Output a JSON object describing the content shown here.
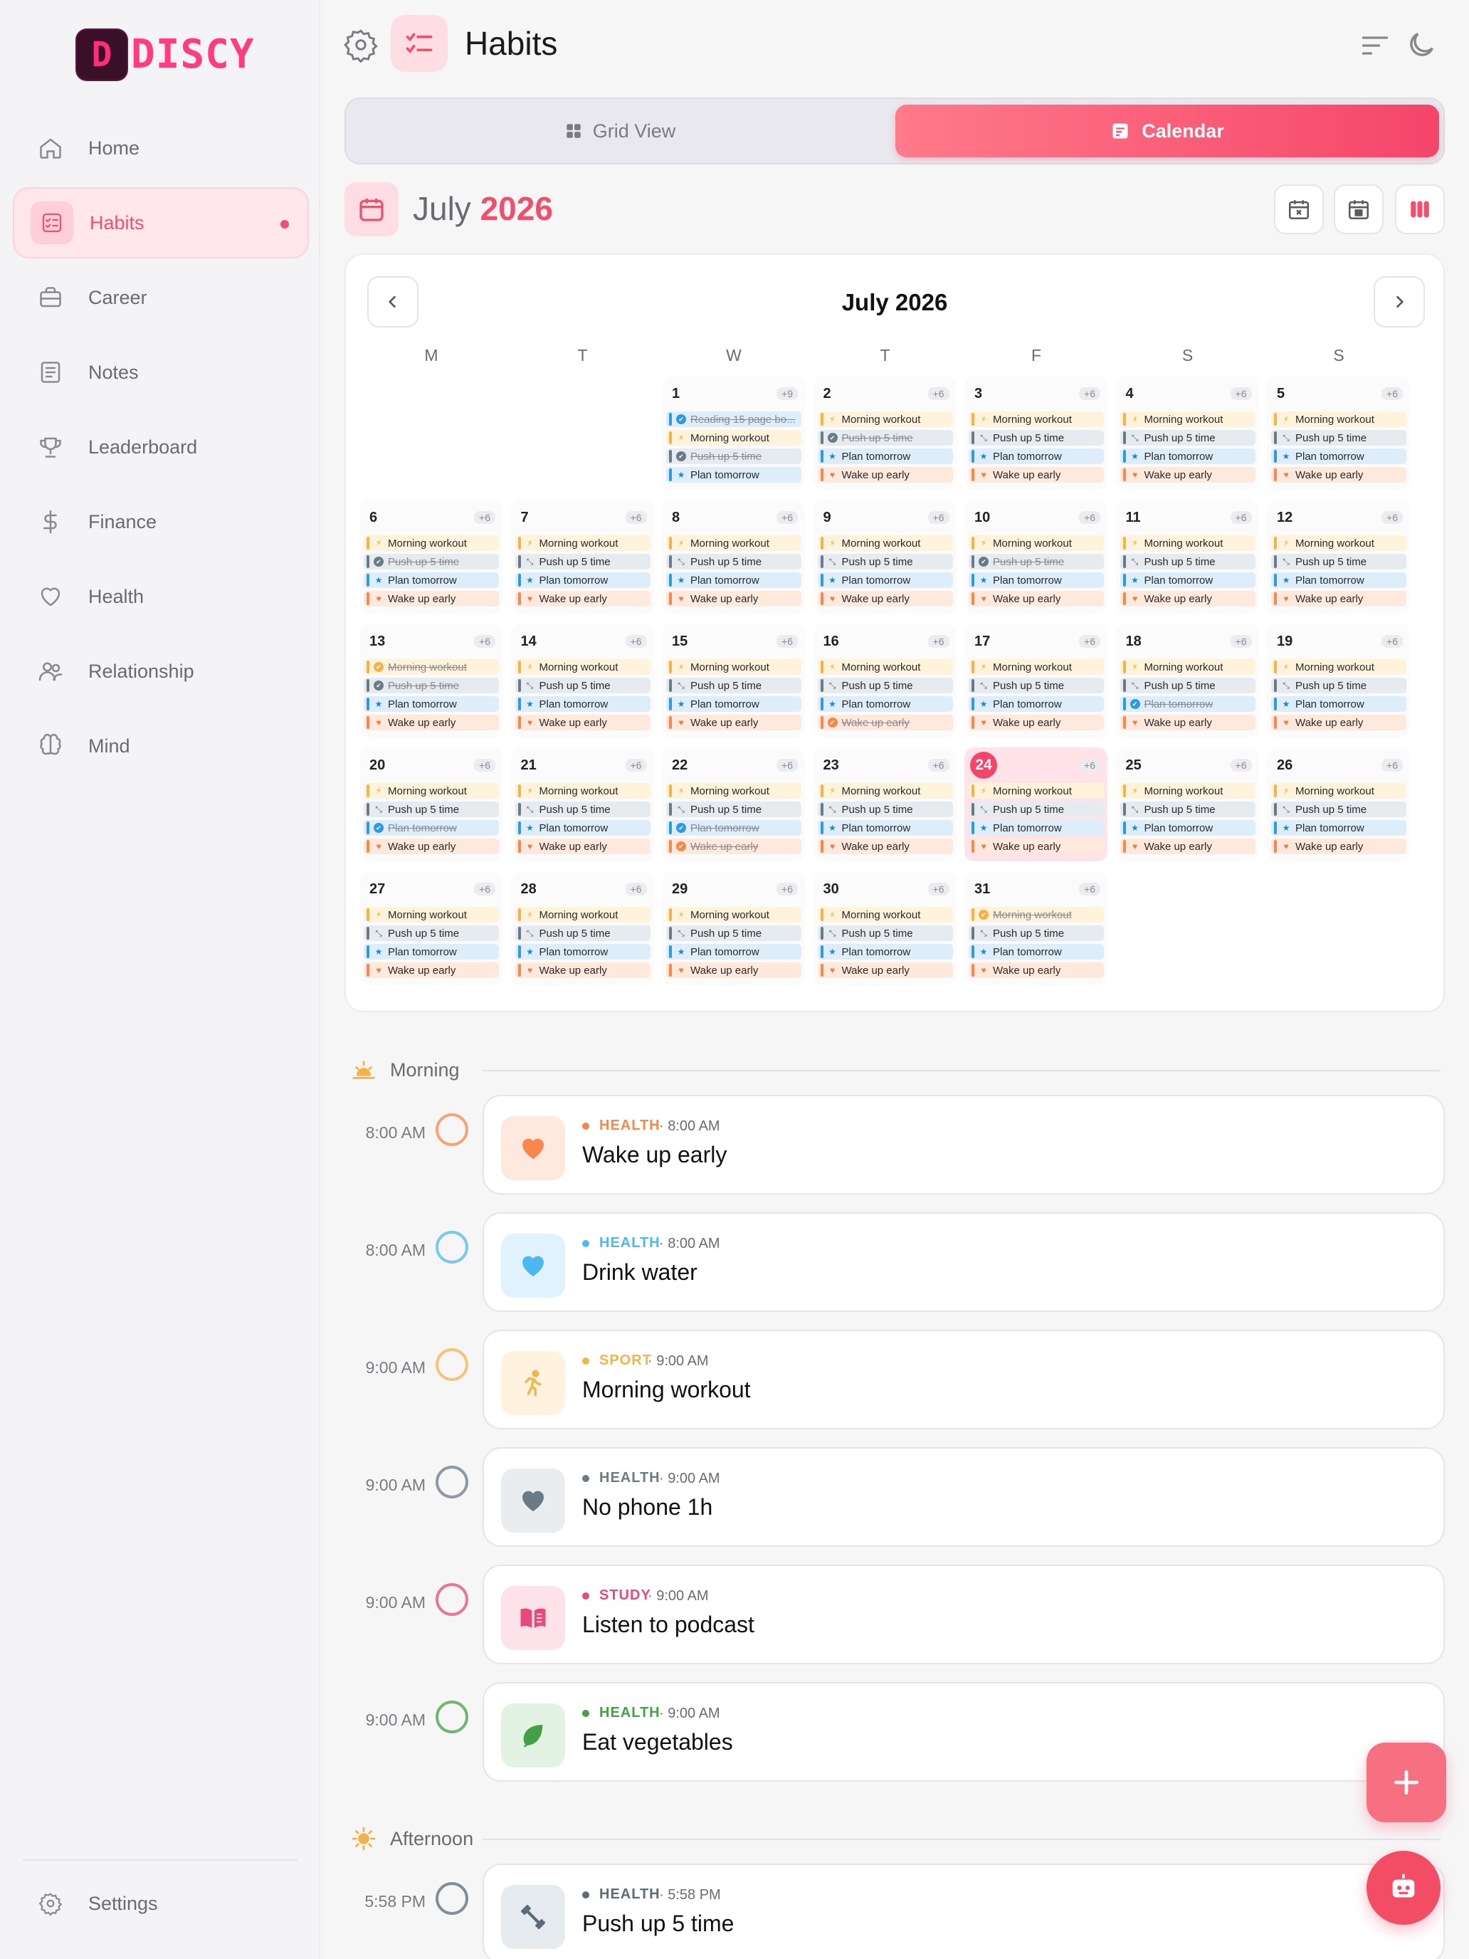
{
  "app": {
    "brand": "DISCY",
    "brand_letter": "D",
    "page_title": "Habits"
  },
  "sidebar": {
    "items": [
      {
        "label": "Home",
        "icon": "home-icon"
      },
      {
        "label": "Habits",
        "icon": "habits-icon",
        "active": true
      },
      {
        "label": "Career",
        "icon": "briefcase-icon"
      },
      {
        "label": "Notes",
        "icon": "notes-icon"
      },
      {
        "label": "Leaderboard",
        "icon": "trophy-icon"
      },
      {
        "label": "Finance",
        "icon": "dollar-icon"
      },
      {
        "label": "Health",
        "icon": "heart-icon"
      },
      {
        "label": "Relationship",
        "icon": "people-icon"
      },
      {
        "label": "Mind",
        "icon": "brain-icon"
      }
    ],
    "settings_label": "Settings"
  },
  "view_toggle": {
    "grid_label": "Grid View",
    "calendar_label": "Calendar",
    "selected": "Calendar"
  },
  "month_header": {
    "month": "July",
    "year": "2026"
  },
  "calendar": {
    "title": "July 2026",
    "weekdays": [
      "M",
      "T",
      "W",
      "T",
      "F",
      "S",
      "S"
    ],
    "first_weekday_index": 2,
    "today": 24,
    "days": [
      {
        "n": "1",
        "more": "+9",
        "events": [
          [
            "read",
            "Reading 15 page bo...",
            true
          ],
          [
            "workout",
            "Morning workout",
            false
          ],
          [
            "push",
            "Push up 5 time",
            true
          ],
          [
            "plan",
            "Plan tomorrow",
            false
          ]
        ]
      },
      {
        "n": "2",
        "more": "+6",
        "events": [
          [
            "workout",
            "Morning workout",
            false
          ],
          [
            "push",
            "Push up 5 time",
            true
          ],
          [
            "plan",
            "Plan tomorrow",
            false
          ],
          [
            "wake",
            "Wake up early",
            false
          ]
        ]
      },
      {
        "n": "3",
        "more": "+6",
        "events": [
          [
            "workout",
            "Morning workout",
            false
          ],
          [
            "push",
            "Push up 5 time",
            false
          ],
          [
            "plan",
            "Plan tomorrow",
            false
          ],
          [
            "wake",
            "Wake up early",
            false
          ]
        ]
      },
      {
        "n": "4",
        "more": "+6",
        "events": [
          [
            "workout",
            "Morning workout",
            false
          ],
          [
            "push",
            "Push up 5 time",
            false
          ],
          [
            "plan",
            "Plan tomorrow",
            false
          ],
          [
            "wake",
            "Wake up early",
            false
          ]
        ]
      },
      {
        "n": "5",
        "more": "+6",
        "events": [
          [
            "workout",
            "Morning workout",
            false
          ],
          [
            "push",
            "Push up 5 time",
            false
          ],
          [
            "plan",
            "Plan tomorrow",
            false
          ],
          [
            "wake",
            "Wake up early",
            false
          ]
        ]
      },
      {
        "n": "6",
        "more": "+6",
        "events": [
          [
            "workout",
            "Morning workout",
            false
          ],
          [
            "push",
            "Push up 5 time",
            true
          ],
          [
            "plan",
            "Plan tomorrow",
            false
          ],
          [
            "wake",
            "Wake up early",
            false
          ]
        ]
      },
      {
        "n": "7",
        "more": "+6",
        "events": [
          [
            "workout",
            "Morning workout",
            false
          ],
          [
            "push",
            "Push up 5 time",
            false
          ],
          [
            "plan",
            "Plan tomorrow",
            false
          ],
          [
            "wake",
            "Wake up early",
            false
          ]
        ]
      },
      {
        "n": "8",
        "more": "+6",
        "events": [
          [
            "workout",
            "Morning workout",
            false
          ],
          [
            "push",
            "Push up 5 time",
            false
          ],
          [
            "plan",
            "Plan tomorrow",
            false
          ],
          [
            "wake",
            "Wake up early",
            false
          ]
        ]
      },
      {
        "n": "9",
        "more": "+6",
        "events": [
          [
            "workout",
            "Morning workout",
            false
          ],
          [
            "push",
            "Push up 5 time",
            false
          ],
          [
            "plan",
            "Plan tomorrow",
            false
          ],
          [
            "wake",
            "Wake up early",
            false
          ]
        ]
      },
      {
        "n": "10",
        "more": "+6",
        "events": [
          [
            "workout",
            "Morning workout",
            false
          ],
          [
            "push",
            "Push up 5 time",
            true
          ],
          [
            "plan",
            "Plan tomorrow",
            false
          ],
          [
            "wake",
            "Wake up early",
            false
          ]
        ]
      },
      {
        "n": "11",
        "more": "+6",
        "events": [
          [
            "workout",
            "Morning workout",
            false
          ],
          [
            "push",
            "Push up 5 time",
            false
          ],
          [
            "plan",
            "Plan tomorrow",
            false
          ],
          [
            "wake",
            "Wake up early",
            false
          ]
        ]
      },
      {
        "n": "12",
        "more": "+6",
        "events": [
          [
            "workout",
            "Morning workout",
            false
          ],
          [
            "push",
            "Push up 5 time",
            false
          ],
          [
            "plan",
            "Plan tomorrow",
            false
          ],
          [
            "wake",
            "Wake up early",
            false
          ]
        ]
      },
      {
        "n": "13",
        "more": "+6",
        "events": [
          [
            "workout",
            "Morning workout",
            true
          ],
          [
            "push",
            "Push up 5 time",
            true
          ],
          [
            "plan",
            "Plan tomorrow",
            false
          ],
          [
            "wake",
            "Wake up early",
            false
          ]
        ]
      },
      {
        "n": "14",
        "more": "+6",
        "events": [
          [
            "workout",
            "Morning workout",
            false
          ],
          [
            "push",
            "Push up 5 time",
            false
          ],
          [
            "plan",
            "Plan tomorrow",
            false
          ],
          [
            "wake",
            "Wake up early",
            false
          ]
        ]
      },
      {
        "n": "15",
        "more": "+6",
        "events": [
          [
            "workout",
            "Morning workout",
            false
          ],
          [
            "push",
            "Push up 5 time",
            false
          ],
          [
            "plan",
            "Plan tomorrow",
            false
          ],
          [
            "wake",
            "Wake up early",
            false
          ]
        ]
      },
      {
        "n": "16",
        "more": "+6",
        "events": [
          [
            "workout",
            "Morning workout",
            false
          ],
          [
            "push",
            "Push up 5 time",
            false
          ],
          [
            "plan",
            "Plan tomorrow",
            false
          ],
          [
            "wake",
            "Wake up early",
            true
          ]
        ]
      },
      {
        "n": "17",
        "more": "+6",
        "events": [
          [
            "workout",
            "Morning workout",
            false
          ],
          [
            "push",
            "Push up 5 time",
            false
          ],
          [
            "plan",
            "Plan tomorrow",
            false
          ],
          [
            "wake",
            "Wake up early",
            false
          ]
        ]
      },
      {
        "n": "18",
        "more": "+6",
        "events": [
          [
            "workout",
            "Morning workout",
            false
          ],
          [
            "push",
            "Push up 5 time",
            false
          ],
          [
            "plan",
            "Plan tomorrow",
            true
          ],
          [
            "wake",
            "Wake up early",
            false
          ]
        ]
      },
      {
        "n": "19",
        "more": "+6",
        "events": [
          [
            "workout",
            "Morning workout",
            false
          ],
          [
            "push",
            "Push up 5 time",
            false
          ],
          [
            "plan",
            "Plan tomorrow",
            false
          ],
          [
            "wake",
            "Wake up early",
            false
          ]
        ]
      },
      {
        "n": "20",
        "more": "+6",
        "events": [
          [
            "workout",
            "Morning workout",
            false
          ],
          [
            "push",
            "Push up 5 time",
            false
          ],
          [
            "plan",
            "Plan tomorrow",
            true
          ],
          [
            "wake",
            "Wake up early",
            false
          ]
        ]
      },
      {
        "n": "21",
        "more": "+6",
        "events": [
          [
            "workout",
            "Morning workout",
            false
          ],
          [
            "push",
            "Push up 5 time",
            false
          ],
          [
            "plan",
            "Plan tomorrow",
            false
          ],
          [
            "wake",
            "Wake up early",
            false
          ]
        ]
      },
      {
        "n": "22",
        "more": "+6",
        "events": [
          [
            "workout",
            "Morning workout",
            false
          ],
          [
            "push",
            "Push up 5 time",
            false
          ],
          [
            "plan",
            "Plan tomorrow",
            true
          ],
          [
            "wake",
            "Wake up early",
            true
          ]
        ]
      },
      {
        "n": "23",
        "more": "+6",
        "events": [
          [
            "workout",
            "Morning workout",
            false
          ],
          [
            "push",
            "Push up 5 time",
            false
          ],
          [
            "plan",
            "Plan tomorrow",
            false
          ],
          [
            "wake",
            "Wake up early",
            false
          ]
        ]
      },
      {
        "n": "24",
        "more": "+6",
        "events": [
          [
            "workout",
            "Morning workout",
            false
          ],
          [
            "push",
            "Push up 5 time",
            false
          ],
          [
            "plan",
            "Plan tomorrow",
            false
          ],
          [
            "wake",
            "Wake up early",
            false
          ]
        ]
      },
      {
        "n": "25",
        "more": "+6",
        "events": [
          [
            "workout",
            "Morning workout",
            false
          ],
          [
            "push",
            "Push up 5 time",
            false
          ],
          [
            "plan",
            "Plan tomorrow",
            false
          ],
          [
            "wake",
            "Wake up early",
            false
          ]
        ]
      },
      {
        "n": "26",
        "more": "+6",
        "events": [
          [
            "workout",
            "Morning workout",
            false
          ],
          [
            "push",
            "Push up 5 time",
            false
          ],
          [
            "plan",
            "Plan tomorrow",
            false
          ],
          [
            "wake",
            "Wake up early",
            false
          ]
        ]
      },
      {
        "n": "27",
        "more": "+6",
        "events": [
          [
            "workout",
            "Morning workout",
            false
          ],
          [
            "push",
            "Push up 5 time",
            false
          ],
          [
            "plan",
            "Plan tomorrow",
            false
          ],
          [
            "wake",
            "Wake up early",
            false
          ]
        ]
      },
      {
        "n": "28",
        "more": "+6",
        "events": [
          [
            "workout",
            "Morning workout",
            false
          ],
          [
            "push",
            "Push up 5 time",
            false
          ],
          [
            "plan",
            "Plan tomorrow",
            false
          ],
          [
            "wake",
            "Wake up early",
            false
          ]
        ]
      },
      {
        "n": "29",
        "more": "+6",
        "events": [
          [
            "workout",
            "Morning workout",
            false
          ],
          [
            "push",
            "Push up 5 time",
            false
          ],
          [
            "plan",
            "Plan tomorrow",
            false
          ],
          [
            "wake",
            "Wake up early",
            false
          ]
        ]
      },
      {
        "n": "30",
        "more": "+6",
        "events": [
          [
            "workout",
            "Morning workout",
            false
          ],
          [
            "push",
            "Push up 5 time",
            false
          ],
          [
            "plan",
            "Plan tomorrow",
            false
          ],
          [
            "wake",
            "Wake up early",
            false
          ]
        ]
      },
      {
        "n": "31",
        "more": "+6",
        "events": [
          [
            "workout",
            "Morning workout",
            true
          ],
          [
            "push",
            "Push up 5 time",
            false
          ],
          [
            "plan",
            "Plan tomorrow",
            false
          ],
          [
            "wake",
            "Wake up early",
            false
          ]
        ]
      }
    ]
  },
  "sections": {
    "morning": "Morning",
    "afternoon": "Afternoon"
  },
  "habits": [
    {
      "time": "8:00 AM",
      "category": "HEALTH",
      "cat_time": "· 8:00 AM",
      "name": "Wake up early",
      "color": "#f7874a",
      "bg": "#ffe9de",
      "icon": "heart-icon"
    },
    {
      "time": "8:00 AM",
      "category": "HEALTH",
      "cat_time": "· 8:00 AM",
      "name": "Drink water",
      "color": "#4cb8f0",
      "bg": "#e0f3fd",
      "icon": "heart-icon"
    },
    {
      "time": "9:00 AM",
      "category": "SPORT",
      "cat_time": "· 9:00 AM",
      "name": "Morning workout",
      "color": "#f4b34a",
      "bg": "#fff2df",
      "icon": "runner-icon"
    },
    {
      "time": "9:00 AM",
      "category": "HEALTH",
      "cat_time": "· 9:00 AM",
      "name": "No phone 1h",
      "color": "#6b7a87",
      "bg": "#e9edf0",
      "icon": "heart-icon"
    },
    {
      "time": "9:00 AM",
      "category": "STUDY",
      "cat_time": "· 9:00 AM",
      "name": "Listen to podcast",
      "color": "#e8487c",
      "bg": "#fde2ea",
      "icon": "book-icon"
    },
    {
      "time": "9:00 AM",
      "category": "HEALTH",
      "cat_time": "· 9:00 AM",
      "name": "Eat vegetables",
      "color": "#43a047",
      "bg": "#e2f2e3",
      "icon": "leaf-icon"
    },
    {
      "time": "5:58 PM",
      "category": "HEALTH",
      "cat_time": "· 5:58 PM",
      "name": "Push up 5 time",
      "color": "#5b6b78",
      "bg": "#e6ebef",
      "icon": "dumbbell-icon"
    }
  ]
}
